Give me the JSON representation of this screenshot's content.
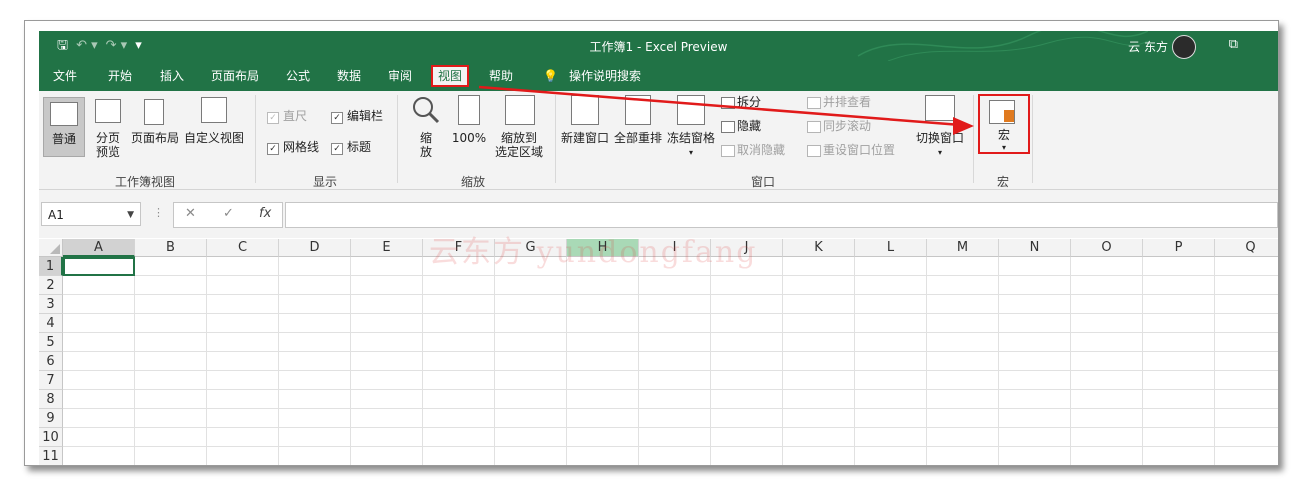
{
  "titlebar": {
    "title": "工作簿1  -  Excel Preview",
    "user": "云 东方",
    "qat_save": "🖫",
    "qat_undo": "↶ ▾",
    "qat_redo": "↷ ▾",
    "qat_more": "▾",
    "restore_icon": "⧉"
  },
  "tabs": [
    "文件",
    "开始",
    "插入",
    "页面布局",
    "公式",
    "数据",
    "审阅",
    "视图",
    "帮助",
    "操作说明搜索"
  ],
  "active_tab": "视图",
  "search_icon": "lightbulb-icon",
  "ribbon": {
    "workbook_views": {
      "label": "工作簿视图",
      "normal": "普通",
      "page_break_line1": "分页",
      "page_break_line2": "预览",
      "page_layout": "页面布局",
      "custom_views": "自定义视图"
    },
    "show": {
      "label": "显示",
      "ruler": "直尺",
      "formula_bar": "编辑栏",
      "gridlines": "网格线",
      "headings": "标题",
      "ruler_checked": true,
      "formula_bar_checked": true,
      "gridlines_checked": true,
      "headings_checked": true
    },
    "zoom": {
      "label": "缩放",
      "zoom_line1": "缩",
      "zoom_line2": "放",
      "hundred": "100%",
      "zoom_sel_line1": "缩放到",
      "zoom_sel_line2": "选定区域"
    },
    "window": {
      "label": "窗口",
      "new_window": "新建窗口",
      "arrange_all": "全部重排",
      "freeze_panes": "冻结窗格",
      "split": "拆分",
      "hide": "隐藏",
      "unhide": "取消隐藏",
      "side_by_side": "并排查看",
      "sync_scroll": "同步滚动",
      "reset_position": "重设窗口位置",
      "switch_windows": "切换窗口"
    },
    "macros": {
      "label": "宏",
      "macros": "宏"
    }
  },
  "formula_bar": {
    "name_box": "A1",
    "cancel": "✕",
    "enter": "✓",
    "fx": "fx",
    "value": ""
  },
  "grid": {
    "columns": [
      "A",
      "B",
      "C",
      "D",
      "E",
      "F",
      "G",
      "H",
      "I",
      "J",
      "K",
      "L",
      "M",
      "N",
      "O",
      "P",
      "Q"
    ],
    "rows": [
      "1",
      "2",
      "3",
      "4",
      "5",
      "6",
      "7",
      "8",
      "9",
      "10",
      "11"
    ],
    "selected_cell": "A1",
    "highlighted_column": "H",
    "watermark": "云东方 yundongfang"
  },
  "colors": {
    "excel_green": "#217346",
    "annotation_red": "#e11a1a"
  }
}
